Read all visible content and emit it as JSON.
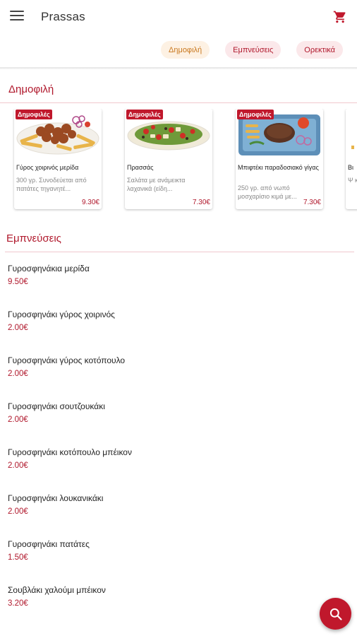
{
  "header": {
    "title": "Prassas",
    "menu_icon": "hamburger-menu-icon",
    "cart_icon": "cart-icon"
  },
  "chips": [
    {
      "label": "Δημοφιλή",
      "active": true
    },
    {
      "label": "Εμπνεύσεις",
      "active": false
    },
    {
      "label": "Ορεκτικά",
      "active": false
    }
  ],
  "popular": {
    "title": "Δημοφιλή",
    "badge": "Δημοφιλές",
    "cards": [
      {
        "name": "Γύρος χοιρινός μερίδα",
        "desc": "300 γρ. Συνοδεύεται από πατάτες τηγανητέ...",
        "price": "9.30€"
      },
      {
        "name": "Πρασσάς",
        "desc": "Σαλάτα με ανάμεικτα λαχανικά (είδη...",
        "price": "7.30€"
      },
      {
        "name": "Μπιφτέκι παραδοσιακό γίγας",
        "desc": "250 γρ. από νωπό μοσχαρίσιο κιμά με...",
        "price": "7.30€"
      },
      {
        "name": "Βι",
        "desc": "Ψ κο",
        "price": ""
      }
    ]
  },
  "inspirations": {
    "title": "Εμπνεύσεις",
    "items": [
      {
        "name": "Γυροσφηνάκια μερίδα",
        "price": "9.50€"
      },
      {
        "name": "Γυροσφηνάκι γύρος χοιρινός",
        "price": "2.00€"
      },
      {
        "name": "Γυροσφηνάκι γύρος κοτόπουλο",
        "price": "2.00€"
      },
      {
        "name": "Γυροσφηνάκι σουτζουκάκι",
        "price": "2.00€"
      },
      {
        "name": "Γυροσφηνάκι κοτόπουλο μπέικον",
        "price": "2.00€"
      },
      {
        "name": "Γυροσφηνάκι λουκανικάκι",
        "price": "2.00€"
      },
      {
        "name": "Γυροσφηνάκι πατάτες",
        "price": "1.50€"
      },
      {
        "name": "Σουβλάκι χαλούμι μπέικον",
        "price": "3.20€"
      }
    ]
  },
  "fab": {
    "icon": "search-icon"
  },
  "colors": {
    "brand": "#c0182c",
    "chip_active_text": "#c9781f",
    "chip_active_bg": "#fdf1e3",
    "chip_bg": "#fbe8ea"
  }
}
